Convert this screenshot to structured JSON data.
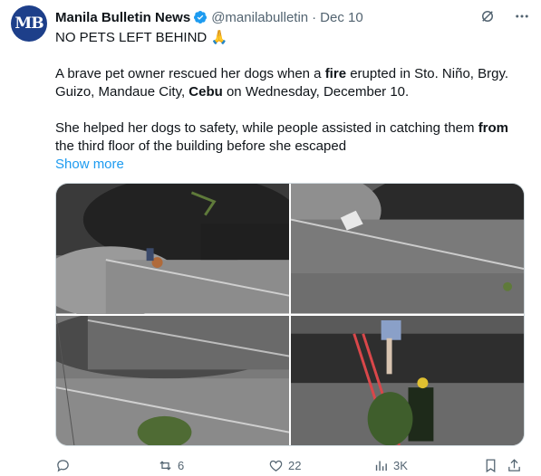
{
  "author": {
    "avatar_text": "MB",
    "name": "Manila Bulletin News",
    "handle": "@manilabulletin",
    "separator": "·",
    "date": "Dec 10"
  },
  "tweet": {
    "line1_text": "NO PETS LEFT BEHIND ",
    "line1_emoji": "🙏",
    "p2_a": "A brave pet owner rescued her dogs when a ",
    "p2_b": "fire",
    "p2_c": " erupted in Sto. Niño, Brgy.",
    "p2_d": "Guizo, Mandaue City, ",
    "p2_e": "Cebu",
    "p2_f": " on Wednesday, December 10.",
    "p3_a": "She helped her dogs to safety, while people assisted in catching them ",
    "p3_b": "from",
    "p3_c": "the third floor of the building before she escaped",
    "show_more": "Show more"
  },
  "actions": {
    "reply_count": "",
    "retweet_count": "6",
    "like_count": "22",
    "views_count": "3K"
  },
  "colors": {
    "accent": "#1d9bf0",
    "muted": "#536471",
    "verified": "#1d9bf0"
  },
  "icons": [
    "verified-badge-icon",
    "grok-icon",
    "more-icon",
    "reply-icon",
    "retweet-icon",
    "like-icon",
    "views-icon",
    "bookmark-icon",
    "share-icon"
  ]
}
